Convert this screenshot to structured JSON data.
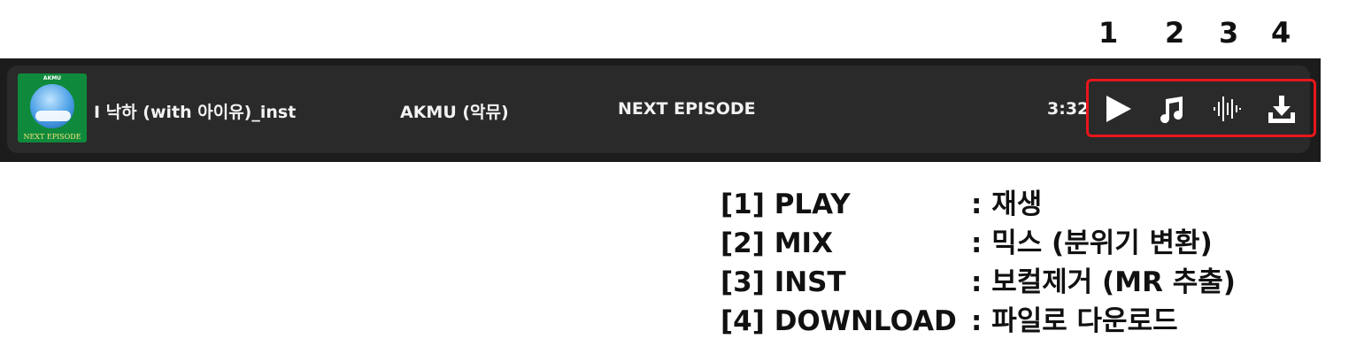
{
  "callouts": {
    "n1": "1",
    "n2": "2",
    "n3": "3",
    "n4": "4"
  },
  "track": {
    "cover": {
      "brand": "AKMU",
      "text": "NEXT EPISODE"
    },
    "title": "I 낙하 (with 아이유)_inst",
    "artist": "AKMU (악뮤)",
    "album": "NEXT EPISODE",
    "duration": "3:32"
  },
  "actions": [
    {
      "icon": "play-icon"
    },
    {
      "icon": "music-note-icon"
    },
    {
      "icon": "waveform-icon"
    },
    {
      "icon": "download-icon"
    }
  ],
  "highlight_color": "#e8161b",
  "legend": [
    {
      "key": "[1]  PLAY",
      "desc": ": 재생"
    },
    {
      "key": "[2]  MIX",
      "desc": ": 믹스 (분위기 변환)"
    },
    {
      "key": "[3]  INST",
      "desc": ": 보컬제거 (MR 추출)"
    },
    {
      "key": "[4]  DOWNLOAD",
      "desc": ": 파일로 다운로드"
    }
  ]
}
